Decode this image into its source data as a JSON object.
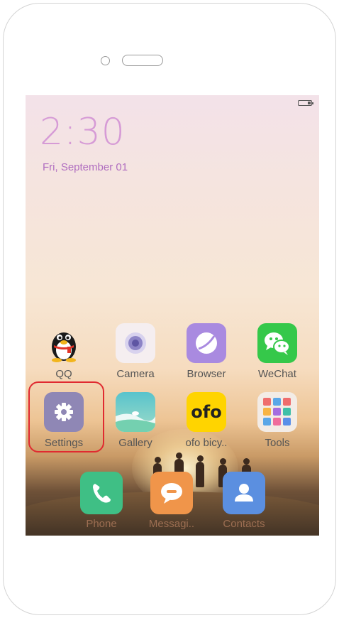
{
  "status_bar": {
    "battery_icon": "battery-icon"
  },
  "lock": {
    "time": "2:30",
    "date": "Fri, September 01"
  },
  "apps": [
    {
      "label": "QQ",
      "icon": "qq-penguin-icon"
    },
    {
      "label": "Camera",
      "icon": "camera-lens-icon"
    },
    {
      "label": "Browser",
      "icon": "browser-globe-icon"
    },
    {
      "label": "WeChat",
      "icon": "wechat-bubbles-icon"
    },
    {
      "label": "Settings",
      "icon": "gear-icon",
      "highlighted": true
    },
    {
      "label": "Gallery",
      "icon": "gallery-landscape-icon"
    },
    {
      "label": "ofo bicy..",
      "icon": "ofo-logo-icon",
      "logo_text": "ofo"
    },
    {
      "label": "Tools",
      "icon": "tools-folder-icon"
    }
  ],
  "dock": [
    {
      "label": "Phone",
      "icon": "phone-handset-icon"
    },
    {
      "label": "Messagi..",
      "icon": "message-bubble-icon"
    },
    {
      "label": "Contacts",
      "icon": "contact-person-icon"
    }
  ],
  "colors": {
    "clock": "#d69bd6",
    "highlight": "#e02a30",
    "wechat": "#35c84a",
    "ofo": "#ffd400",
    "browser": "#a98ae0",
    "settings": "#8f87b5",
    "phone": "#3fbf85",
    "messaging": "#f0954a",
    "contacts": "#5b8fe0"
  }
}
